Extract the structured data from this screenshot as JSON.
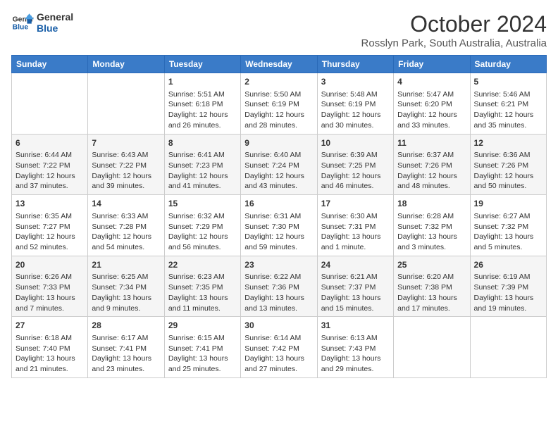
{
  "logo": {
    "line1": "General",
    "line2": "Blue"
  },
  "title": "October 2024",
  "subtitle": "Rosslyn Park, South Australia, Australia",
  "headers": [
    "Sunday",
    "Monday",
    "Tuesday",
    "Wednesday",
    "Thursday",
    "Friday",
    "Saturday"
  ],
  "weeks": [
    [
      {
        "day": "",
        "info": ""
      },
      {
        "day": "",
        "info": ""
      },
      {
        "day": "1",
        "info": "Sunrise: 5:51 AM\nSunset: 6:18 PM\nDaylight: 12 hours and 26 minutes."
      },
      {
        "day": "2",
        "info": "Sunrise: 5:50 AM\nSunset: 6:19 PM\nDaylight: 12 hours and 28 minutes."
      },
      {
        "day": "3",
        "info": "Sunrise: 5:48 AM\nSunset: 6:19 PM\nDaylight: 12 hours and 30 minutes."
      },
      {
        "day": "4",
        "info": "Sunrise: 5:47 AM\nSunset: 6:20 PM\nDaylight: 12 hours and 33 minutes."
      },
      {
        "day": "5",
        "info": "Sunrise: 5:46 AM\nSunset: 6:21 PM\nDaylight: 12 hours and 35 minutes."
      }
    ],
    [
      {
        "day": "6",
        "info": "Sunrise: 6:44 AM\nSunset: 7:22 PM\nDaylight: 12 hours and 37 minutes."
      },
      {
        "day": "7",
        "info": "Sunrise: 6:43 AM\nSunset: 7:22 PM\nDaylight: 12 hours and 39 minutes."
      },
      {
        "day": "8",
        "info": "Sunrise: 6:41 AM\nSunset: 7:23 PM\nDaylight: 12 hours and 41 minutes."
      },
      {
        "day": "9",
        "info": "Sunrise: 6:40 AM\nSunset: 7:24 PM\nDaylight: 12 hours and 43 minutes."
      },
      {
        "day": "10",
        "info": "Sunrise: 6:39 AM\nSunset: 7:25 PM\nDaylight: 12 hours and 46 minutes."
      },
      {
        "day": "11",
        "info": "Sunrise: 6:37 AM\nSunset: 7:26 PM\nDaylight: 12 hours and 48 minutes."
      },
      {
        "day": "12",
        "info": "Sunrise: 6:36 AM\nSunset: 7:26 PM\nDaylight: 12 hours and 50 minutes."
      }
    ],
    [
      {
        "day": "13",
        "info": "Sunrise: 6:35 AM\nSunset: 7:27 PM\nDaylight: 12 hours and 52 minutes."
      },
      {
        "day": "14",
        "info": "Sunrise: 6:33 AM\nSunset: 7:28 PM\nDaylight: 12 hours and 54 minutes."
      },
      {
        "day": "15",
        "info": "Sunrise: 6:32 AM\nSunset: 7:29 PM\nDaylight: 12 hours and 56 minutes."
      },
      {
        "day": "16",
        "info": "Sunrise: 6:31 AM\nSunset: 7:30 PM\nDaylight: 12 hours and 59 minutes."
      },
      {
        "day": "17",
        "info": "Sunrise: 6:30 AM\nSunset: 7:31 PM\nDaylight: 13 hours and 1 minute."
      },
      {
        "day": "18",
        "info": "Sunrise: 6:28 AM\nSunset: 7:32 PM\nDaylight: 13 hours and 3 minutes."
      },
      {
        "day": "19",
        "info": "Sunrise: 6:27 AM\nSunset: 7:32 PM\nDaylight: 13 hours and 5 minutes."
      }
    ],
    [
      {
        "day": "20",
        "info": "Sunrise: 6:26 AM\nSunset: 7:33 PM\nDaylight: 13 hours and 7 minutes."
      },
      {
        "day": "21",
        "info": "Sunrise: 6:25 AM\nSunset: 7:34 PM\nDaylight: 13 hours and 9 minutes."
      },
      {
        "day": "22",
        "info": "Sunrise: 6:23 AM\nSunset: 7:35 PM\nDaylight: 13 hours and 11 minutes."
      },
      {
        "day": "23",
        "info": "Sunrise: 6:22 AM\nSunset: 7:36 PM\nDaylight: 13 hours and 13 minutes."
      },
      {
        "day": "24",
        "info": "Sunrise: 6:21 AM\nSunset: 7:37 PM\nDaylight: 13 hours and 15 minutes."
      },
      {
        "day": "25",
        "info": "Sunrise: 6:20 AM\nSunset: 7:38 PM\nDaylight: 13 hours and 17 minutes."
      },
      {
        "day": "26",
        "info": "Sunrise: 6:19 AM\nSunset: 7:39 PM\nDaylight: 13 hours and 19 minutes."
      }
    ],
    [
      {
        "day": "27",
        "info": "Sunrise: 6:18 AM\nSunset: 7:40 PM\nDaylight: 13 hours and 21 minutes."
      },
      {
        "day": "28",
        "info": "Sunrise: 6:17 AM\nSunset: 7:41 PM\nDaylight: 13 hours and 23 minutes."
      },
      {
        "day": "29",
        "info": "Sunrise: 6:15 AM\nSunset: 7:41 PM\nDaylight: 13 hours and 25 minutes."
      },
      {
        "day": "30",
        "info": "Sunrise: 6:14 AM\nSunset: 7:42 PM\nDaylight: 13 hours and 27 minutes."
      },
      {
        "day": "31",
        "info": "Sunrise: 6:13 AM\nSunset: 7:43 PM\nDaylight: 13 hours and 29 minutes."
      },
      {
        "day": "",
        "info": ""
      },
      {
        "day": "",
        "info": ""
      }
    ]
  ]
}
